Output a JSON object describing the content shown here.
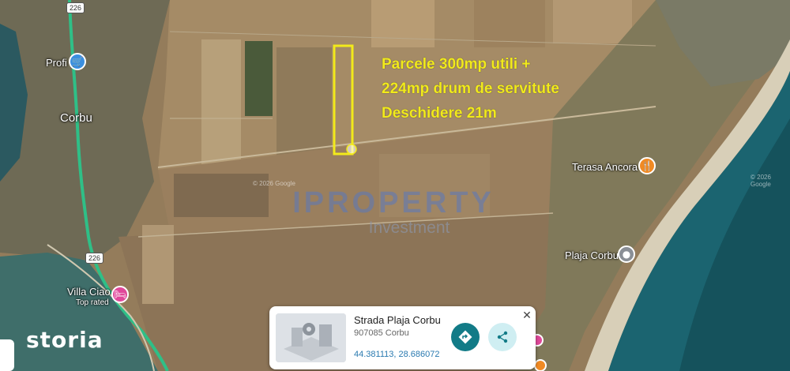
{
  "map": {
    "labels": {
      "town": "Corbu",
      "poi_profi": "Profi",
      "poi_terasa": "Terasa Ancora",
      "poi_plaja": "Plaja Corbu",
      "poi_villa": "Villa Ciao",
      "poi_villa_sub": "Top rated"
    },
    "road_shields": [
      "226",
      "226"
    ],
    "copyright": "© 2026 Google"
  },
  "annotation": {
    "line1": "Parcele 300mp utili +",
    "line2": "224mp drum de servitute",
    "line3": "Deschidere 21m",
    "color": "#f2ea1b"
  },
  "watermark": {
    "title": "IPROPERTY",
    "subtitle": "Investment"
  },
  "brand": "storia",
  "place_card": {
    "title": "Strada Plaja Corbu",
    "address": "907085 Corbu",
    "coords": "44.381113, 28.686072",
    "directions_icon": "directions-icon",
    "share_icon": "share-icon",
    "close_icon": "close-icon"
  },
  "colors": {
    "road": "#2fbf87",
    "sea": "#1b6470",
    "parcel_outline": "#f2ea1b"
  }
}
